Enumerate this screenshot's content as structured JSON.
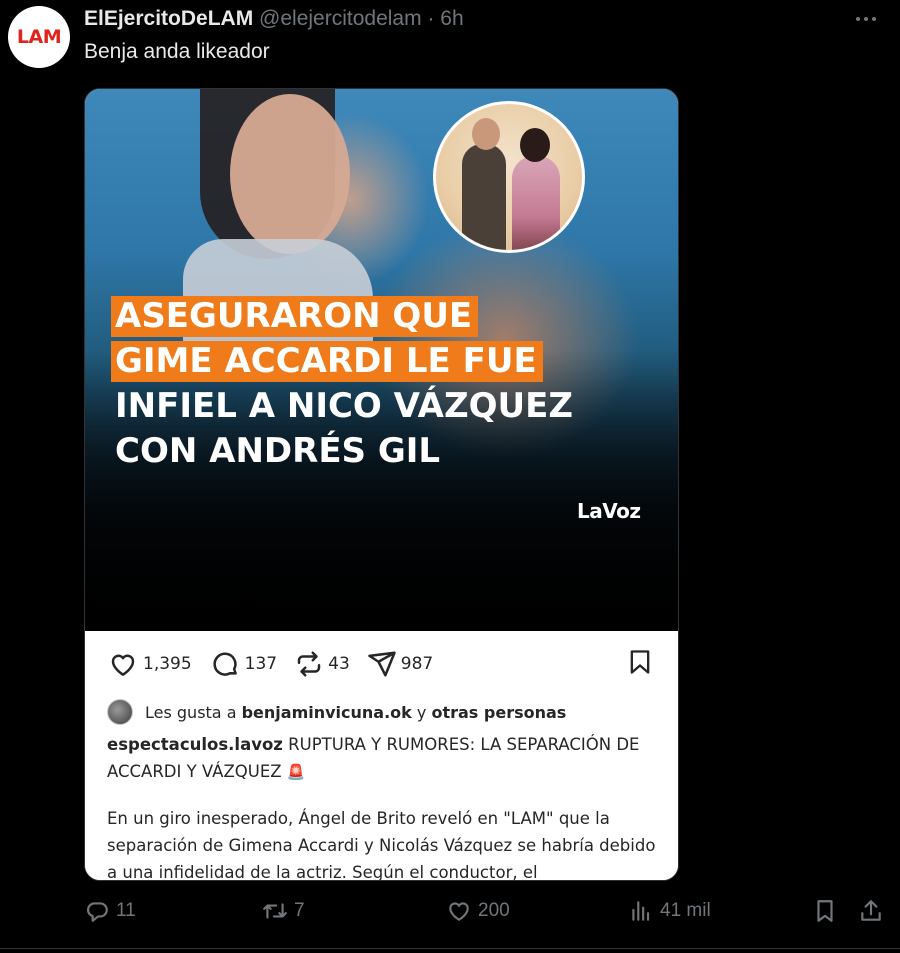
{
  "tweet": {
    "avatar_text": "LAM",
    "name": "ElEjercitoDeLAM",
    "handle": "@elejercitodelam",
    "dot": "·",
    "time": "6h",
    "text": "Benja anda likeador"
  },
  "media": {
    "headline_highlight_1": "ASEGURARON QUE",
    "headline_highlight_2": "GIME ACCARDI LE FUE",
    "headline_line_3": "INFIEL A NICO VÁZQUEZ",
    "headline_line_4": "CON ANDRÉS GIL",
    "logo": "LaVoz",
    "highlight_color": "#f07b1a",
    "instagram": {
      "likes": "1,395",
      "comments": "137",
      "reposts": "43",
      "shares": "987",
      "liked_by_prefix": "Les gusta a",
      "liked_by_user": "benjaminvicuna.ok",
      "liked_by_suffix": "y",
      "liked_by_others": "otras personas",
      "caption_user": "espectaculos.lavoz",
      "caption_title": "RUPTURA Y RUMORES: LA SEPARACIÓN DE ACCARDI Y VÁZQUEZ",
      "caption_emoji": "🚨",
      "caption_body": "En un giro inesperado, Ángel de Brito reveló en \"LAM\" que la separación de Gimena Accardi y Nicolás Vázquez se habría debido a una infidelidad de la actriz. Según el conductor, el"
    }
  },
  "footer": {
    "replies": "11",
    "retweets": "7",
    "likes": "200",
    "views": "41 mil"
  },
  "icons": {
    "more": "more-icon",
    "reply": "reply-icon",
    "retweet": "retweet-icon",
    "like": "heart-icon",
    "views": "views-icon",
    "bookmark": "bookmark-icon",
    "share": "share-icon"
  },
  "colors": {
    "background": "#000000",
    "text": "#e7e9ea",
    "muted": "#71767b",
    "brand_red": "#e0231b"
  }
}
